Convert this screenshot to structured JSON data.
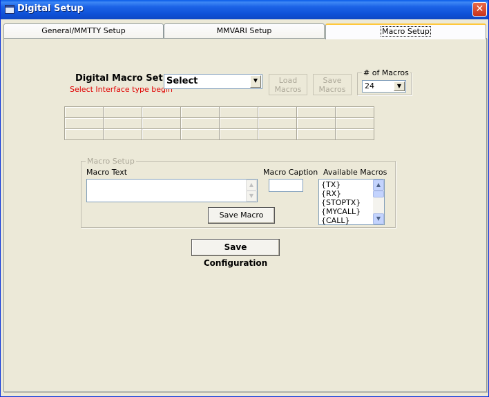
{
  "window": {
    "title": "Digital Setup",
    "close_glyph": "✕"
  },
  "tabs": [
    {
      "label": "General/MMTTY Setup",
      "active": false
    },
    {
      "label": "MMVARI Setup",
      "active": false
    },
    {
      "label": "Macro Setup",
      "active": true
    }
  ],
  "macro_set": {
    "label": "Digital Macro Set",
    "hint": "Select Interface type begin",
    "combo_value": "Select",
    "load_label_1": "Load",
    "load_label_2": "Macros",
    "save_label_1": "Save",
    "save_label_2": "Macros",
    "num_macros_group": "# of Macros",
    "num_macros_value": "24"
  },
  "macro_grid": {
    "rows": 3,
    "cols": 8
  },
  "macro_setup": {
    "group_title": "Macro Setup",
    "macro_text_label": "Macro Text",
    "macro_text_value": "",
    "macro_caption_label": "Macro Caption",
    "macro_caption_value": "",
    "available_label": "Available Macros",
    "available_items": [
      "{TX}",
      "{RX}",
      "{STOPTX}",
      "{MYCALL}",
      "{CALL}"
    ],
    "save_macro_label": "Save Macro"
  },
  "save_config_label": "Save Configuration",
  "colors": {
    "titlebar": "#0f52d9",
    "hint_red": "#e00000",
    "active_tab_accent": "#ffc83c",
    "background": "#ece9d8"
  },
  "icons": {
    "window_icon": "window-icon",
    "close": "close-icon",
    "combo_arrow": "chevron-down-icon",
    "scroll_up": "scroll-up-icon",
    "scroll_down": "scroll-down-icon"
  }
}
